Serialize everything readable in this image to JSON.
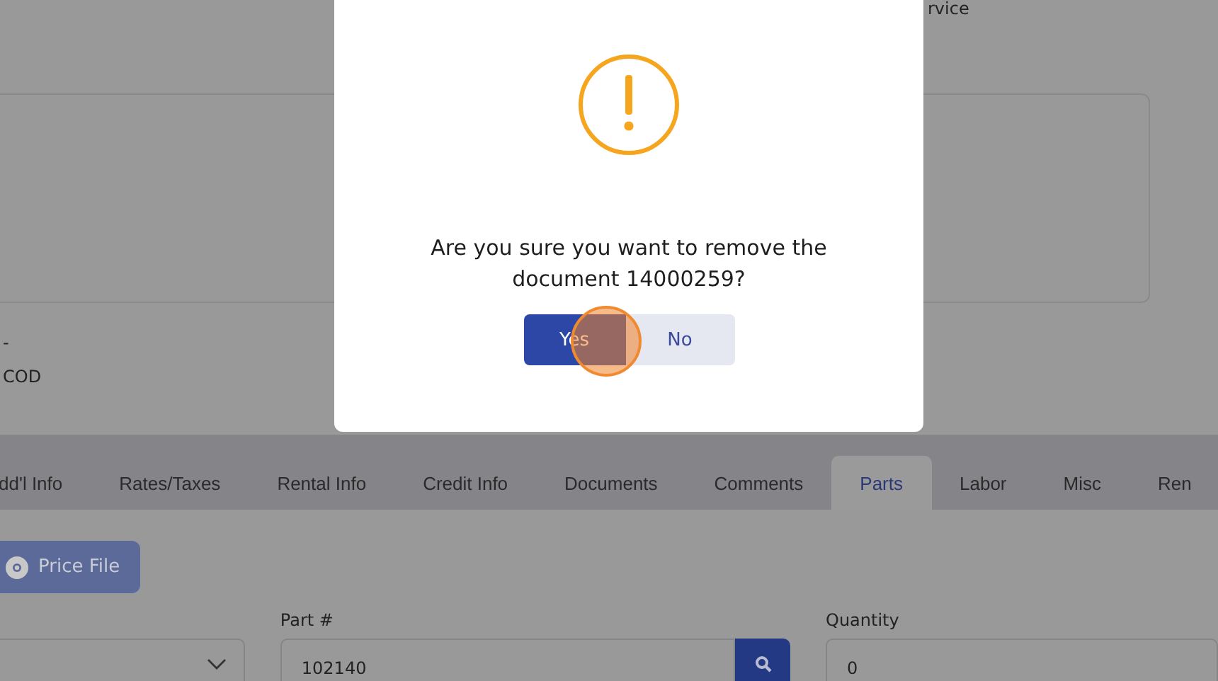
{
  "page": {
    "heading_fragment": "rvice",
    "info_lines": [
      "-",
      "COD"
    ],
    "tabs": [
      {
        "label": "dd'l Info",
        "selected": false
      },
      {
        "label": "Rates/Taxes",
        "selected": false
      },
      {
        "label": "Rental Info",
        "selected": false
      },
      {
        "label": "Credit Info",
        "selected": false
      },
      {
        "label": "Documents",
        "selected": false
      },
      {
        "label": "Comments",
        "selected": false
      },
      {
        "label": "Parts",
        "selected": true
      },
      {
        "label": "Labor",
        "selected": false
      },
      {
        "label": "Misc",
        "selected": false
      },
      {
        "label": "Ren",
        "selected": false
      }
    ],
    "price_file_button": "Price File",
    "fields": [
      {
        "kind": "select"
      },
      {
        "kind": "search",
        "label": "Part #",
        "value": "102140"
      },
      {
        "kind": "text",
        "label": "Quantity",
        "value": "0"
      }
    ]
  },
  "dialog": {
    "message": "Are you sure you want to remove the document 14000259?",
    "buttons": [
      {
        "label": "Yes",
        "kind": "primary"
      },
      {
        "label": "No",
        "kind": "secondary"
      }
    ]
  }
}
